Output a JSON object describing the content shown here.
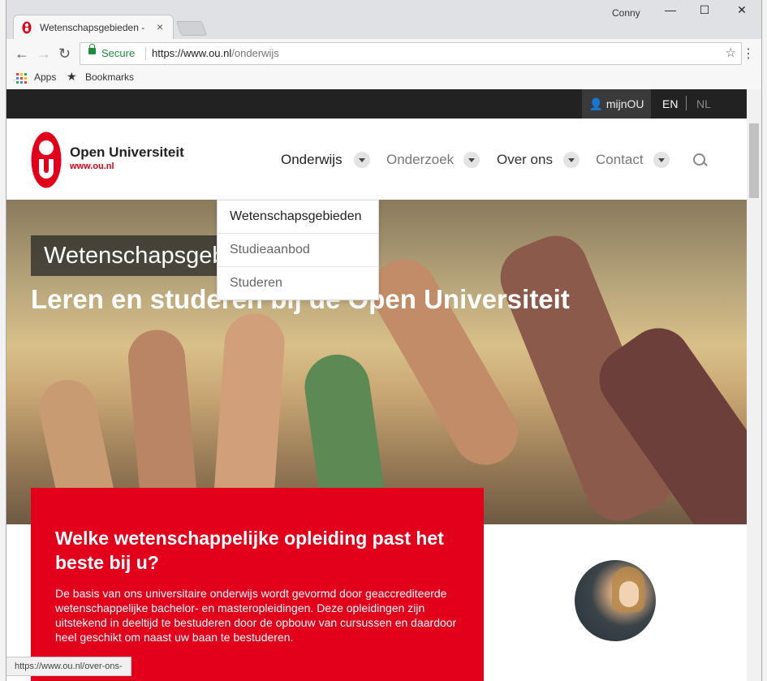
{
  "browser": {
    "tab_title": "Wetenschapsgebieden -",
    "tab_close": "×",
    "user": "Conny",
    "minimize": "—",
    "maximize": "☐",
    "close": "✕",
    "secure_label": "Secure",
    "url_host": "https://www.ou.nl",
    "url_path": "/onderwijs",
    "bookmarks": [
      {
        "label": "Apps",
        "icon": "apps-grid-icon"
      },
      {
        "label": "Bookmarks",
        "icon": "star-icon"
      }
    ],
    "status_url": "https://www.ou.nl/over-ons-"
  },
  "site": {
    "top_bar": {
      "account": "mijnOU",
      "lang_en": "EN",
      "lang_nl": "NL"
    },
    "logo": {
      "name": "Open Universiteit",
      "url": "www.ou.nl"
    },
    "nav": [
      "Onderwijs",
      "Onderzoek",
      "Over ons",
      "Contact"
    ],
    "dropdown": [
      "Wetenschapsgebieden",
      "Studieaanbod",
      "Studeren"
    ],
    "hero": {
      "pill": "Wetenschapsgebieden",
      "headline": "Leren en studeren bij de Open Universiteit"
    },
    "promo": {
      "title": "Welke wetenschappelijke opleiding past het beste bij u?",
      "body": "De basis van ons universitaire onderwijs wordt gevormd door geaccrediteerde wetenschappelijke bachelor- en masteropleidingen. Deze opleidingen zijn uitstekend in deeltijd te bestuderen door de opbouw van cursussen en daardoor heel geschikt om naast uw baan te bestuderen."
    }
  },
  "colors": {
    "brand_red": "#e2001a",
    "top_bar": "#222222",
    "secure_green": "#1e8e3e"
  }
}
